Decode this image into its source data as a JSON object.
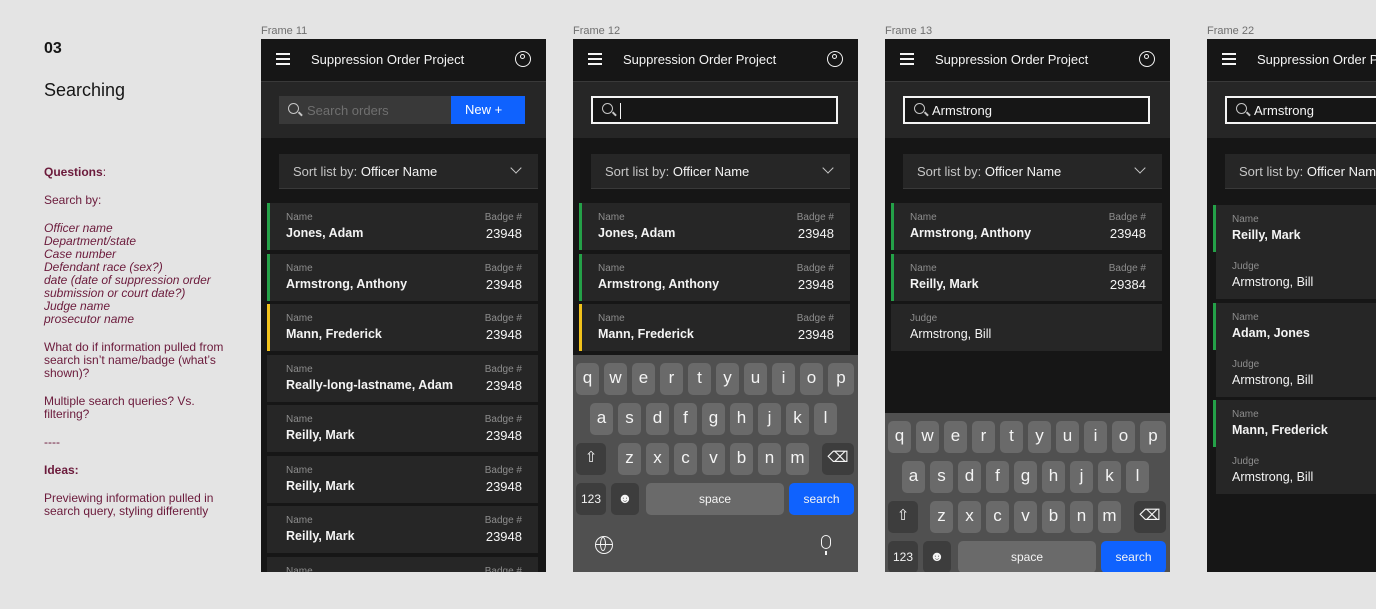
{
  "notes": {
    "number": "03",
    "title": "Searching",
    "questions_heading": "Questions",
    "search_by_label": "Search by:",
    "search_by_items": [
      "Officer name",
      "Department/state",
      "Case number",
      "Defendant race (sex?)",
      "date (date of suppression order submission or court date?)",
      "Judge name",
      "prosecutor name"
    ],
    "question_1": "What do if information pulled from search isn’t name/badge (what’s shown)?",
    "question_2": "Multiple search queries? Vs. filtering?",
    "divider": "----",
    "ideas_heading": "Ideas:",
    "idea_1": "Previewing information pulled in search query, styling differently"
  },
  "app_title": "Suppression Order Project",
  "sort": {
    "label": "Sort list by: ",
    "value": "Officer Name"
  },
  "labels": {
    "name": "Name",
    "badge": "Badge #",
    "judge": "Judge"
  },
  "frames": [
    {
      "label": "Frame 11",
      "search_placeholder": "Search orders",
      "new_button": "New  +",
      "rows": [
        {
          "name": "Jones, Adam",
          "badge": "23948",
          "accent": "green"
        },
        {
          "name": "Armstrong, Anthony",
          "badge": "23948",
          "accent": "green"
        },
        {
          "name": "Mann, Frederick",
          "badge": "23948",
          "accent": "yellow"
        },
        {
          "name": "Really-long-lastname, Adam",
          "badge": "23948",
          "accent": "none"
        },
        {
          "name": "Reilly, Mark",
          "badge": "23948",
          "accent": "none"
        },
        {
          "name": "Reilly, Mark",
          "badge": "23948",
          "accent": "none"
        },
        {
          "name": "Reilly, Mark",
          "badge": "23948",
          "accent": "none"
        }
      ]
    },
    {
      "label": "Frame 12",
      "search_value": "",
      "rows": [
        {
          "name": "Jones, Adam",
          "badge": "23948",
          "accent": "green"
        },
        {
          "name": "Armstrong, Anthony",
          "badge": "23948",
          "accent": "green"
        },
        {
          "name": "Mann, Frederick",
          "badge": "23948",
          "accent": "yellow"
        }
      ]
    },
    {
      "label": "Frame 13",
      "search_value": "Armstrong",
      "rows": [
        {
          "name": "Armstrong, Anthony",
          "badge": "23948",
          "accent": "green"
        },
        {
          "name": "Reilly, Mark",
          "badge": "29384",
          "accent": "green"
        },
        {
          "judge": "Armstrong, Bill"
        }
      ]
    },
    {
      "label": "Frame 22",
      "search_value": "Armstrong",
      "rows": [
        {
          "name": "Reilly, Mark",
          "accent": "green"
        },
        {
          "judge": "Armstrong, Bill"
        },
        {
          "name": "Adam, Jones",
          "accent": "green"
        },
        {
          "judge": "Armstrong, Bill"
        },
        {
          "name": "Mann, Frederick",
          "accent": "green"
        },
        {
          "judge": "Armstrong, Bill"
        }
      ]
    }
  ],
  "keyboard": {
    "row1": [
      "q",
      "w",
      "e",
      "r",
      "t",
      "y",
      "u",
      "i",
      "o",
      "p"
    ],
    "row2": [
      "a",
      "s",
      "d",
      "f",
      "g",
      "h",
      "j",
      "k",
      "l"
    ],
    "row3": [
      "z",
      "x",
      "c",
      "v",
      "b",
      "n",
      "m"
    ],
    "k123": "123",
    "space": "space",
    "search": "search",
    "emoji": "☻",
    "shift": "⇧",
    "backspace": "⌫"
  },
  "icons": [
    "menu-icon",
    "user-avatar-icon",
    "search-icon",
    "chevron-down-icon",
    "globe-icon",
    "microphone-icon"
  ],
  "colors": {
    "background": "#e4e4e4",
    "frame": "#161616",
    "row": "#262626",
    "primary": "#0f62fe",
    "green": "#24a148",
    "yellow": "#f1c21b",
    "notes_text": "#6b1a3b"
  }
}
